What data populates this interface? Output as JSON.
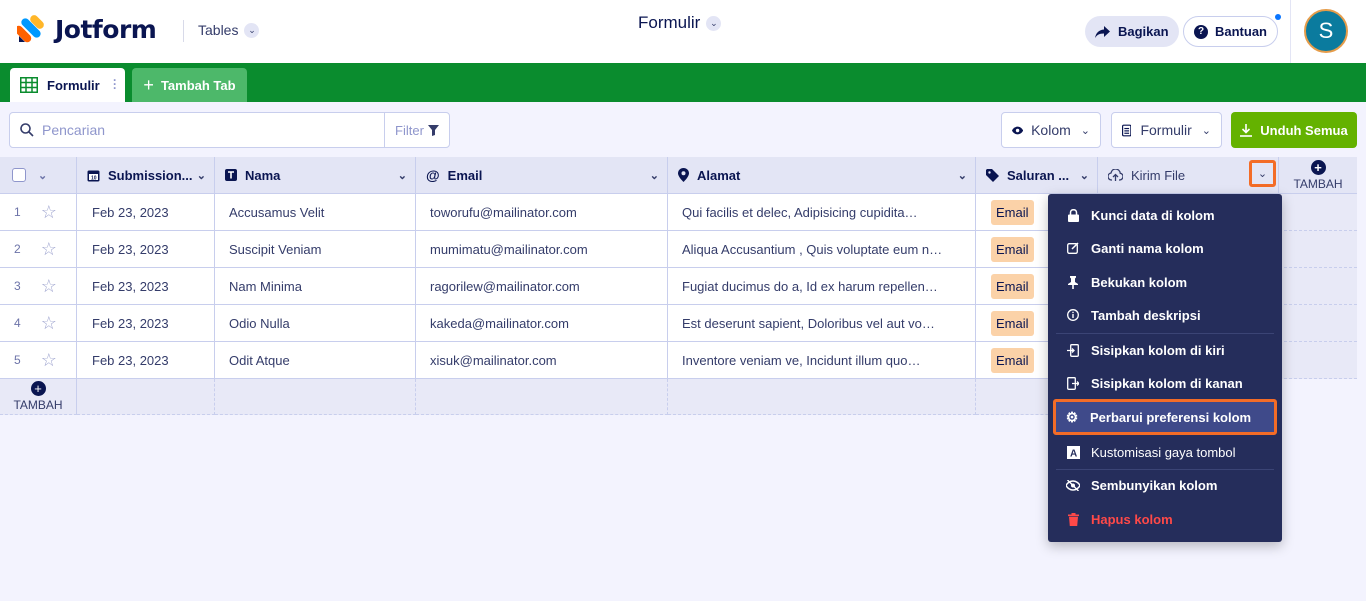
{
  "header": {
    "brand": "Jotform",
    "app_switch": "Tables",
    "title": "Formulir",
    "share_label": "Bagikan",
    "help_label": "Bantuan",
    "avatar_initial": "S"
  },
  "tabs": {
    "active": "Formulir",
    "add_label": "Tambah Tab"
  },
  "toolbar": {
    "search_placeholder": "Pencarian",
    "filter_label": "Filter",
    "columns_label": "Kolom",
    "form_label": "Formulir",
    "download_label": "Unduh Semua"
  },
  "table": {
    "columns": [
      "Submission...",
      "Nama",
      "Email",
      "Alamat",
      "Saluran ...",
      "Kirim File"
    ],
    "add_column_label": "TAMBAH",
    "add_row_label": "TAMBAH",
    "rows": [
      {
        "num": "1",
        "date": "Feb 23, 2023",
        "name": "Accusamus Velit",
        "email": "toworufu@mailinator.com",
        "address": "Qui facilis et delec, Adipisicing cupidita…",
        "channel": "Email"
      },
      {
        "num": "2",
        "date": "Feb 23, 2023",
        "name": "Suscipit Veniam",
        "email": "mumimatu@mailinator.com",
        "address": "Aliqua Accusantium , Quis voluptate eum n…",
        "channel": "Email"
      },
      {
        "num": "3",
        "date": "Feb 23, 2023",
        "name": "Nam Minima",
        "email": "ragorilew@mailinator.com",
        "address": "Fugiat ducimus do a, Id ex harum repellen…",
        "channel": "Email"
      },
      {
        "num": "4",
        "date": "Feb 23, 2023",
        "name": "Odio Nulla",
        "email": "kakeda@mailinator.com",
        "address": "Est deserunt sapient, Doloribus vel aut vo…",
        "channel": "Email"
      },
      {
        "num": "5",
        "date": "Feb 23, 2023",
        "name": "Odit Atque",
        "email": "xisuk@mailinator.com",
        "address": "Inventore veniam ve, Incidunt illum quo…",
        "channel": "Email"
      }
    ]
  },
  "menu": {
    "items": [
      "Kunci data di kolom",
      "Ganti nama kolom",
      "Bekukan kolom",
      "Tambah deskripsi",
      "Sisipkan kolom di kiri",
      "Sisipkan kolom di kanan",
      "Perbarui preferensi kolom",
      "Kustomisasi gaya tombol",
      "Sembunyikan kolom",
      "Hapus kolom"
    ]
  }
}
